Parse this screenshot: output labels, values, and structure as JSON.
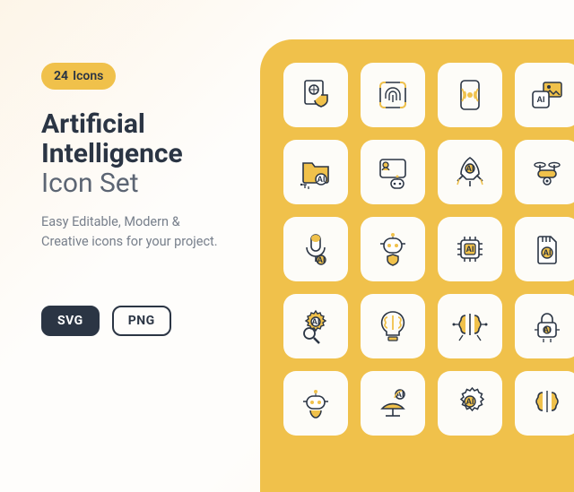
{
  "badge": {
    "count": "24",
    "label": "Icons"
  },
  "title": {
    "line1": "Artificial",
    "line2": "Intelligence",
    "line3": "Icon Set"
  },
  "description": "Easy Editable, Modern & Creative icons for your project.",
  "formats": [
    {
      "label": "SVG",
      "active": true
    },
    {
      "label": "PNG",
      "active": false
    }
  ],
  "icons": [
    "document-shield-icon",
    "fingerprint-icon",
    "wireless-phone-icon",
    "ai-image-icon",
    "ai-folder-icon",
    "chatbot-avatar-icon",
    "ai-rocket-icon",
    "drone-icon",
    "ai-microphone-icon",
    "robot-shield-icon",
    "ai-chip-icon",
    "ai-sd-card-icon",
    "ai-gear-search-icon",
    "brain-bulb-icon",
    "brain-connections-icon",
    "ai-lock-icon",
    "robot-assistant-icon",
    "ai-satellite-icon",
    "ai-gear-icon",
    "brain-chip-icon"
  ],
  "colors": {
    "accent": "#f0c14b",
    "dark": "#2b3544",
    "muted": "#777f8b"
  }
}
